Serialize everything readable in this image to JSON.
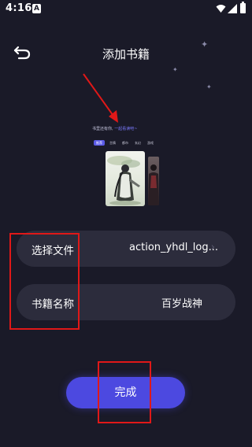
{
  "status_bar": {
    "time": "4:16",
    "notification_badge": "A"
  },
  "header": {
    "title": "添加书籍",
    "back_icon": "back-arrow-icon"
  },
  "preview": {
    "slogan_part1": "书里还有你,",
    "slogan_part2": "一起看读吧~",
    "tabs": [
      "推荐",
      "言情",
      "都市",
      "玄幻",
      "游戏"
    ],
    "active_tab_index": 0
  },
  "form": {
    "file_label": "选择文件",
    "file_value": "action_yhdl_log...",
    "name_label": "书籍名称",
    "name_value": "百岁战神"
  },
  "done_button": {
    "label": "完成"
  },
  "colors": {
    "background": "#1a1a28",
    "row_background": "#2c2c3c",
    "accent": "#4c49e0",
    "annotation": "#e01818"
  }
}
